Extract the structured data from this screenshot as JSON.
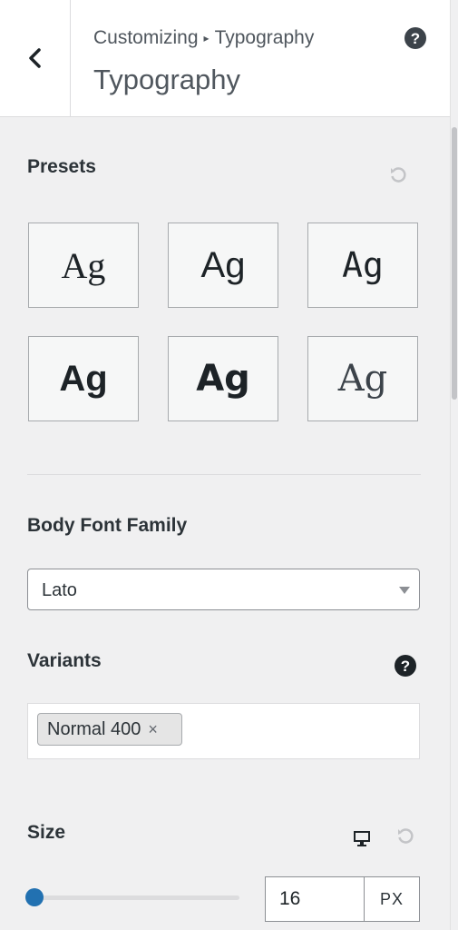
{
  "header": {
    "breadcrumb_parent": "Customizing",
    "breadcrumb_separator": "▸",
    "breadcrumb_current": "Typography",
    "title": "Typography",
    "back_icon": "chevron-left-icon",
    "help_icon": "help-icon"
  },
  "presets": {
    "label": "Presets",
    "reset_icon": "reset-icon",
    "items": [
      {
        "sample": "Ag",
        "style": "serif"
      },
      {
        "sample": "Ag",
        "style": "sans-serif-serif"
      },
      {
        "sample": "Ag",
        "style": "condensed"
      },
      {
        "sample": "Ag",
        "style": "sans-bold-serif"
      },
      {
        "sample": "Ag",
        "style": "sans-bold-serif-2"
      },
      {
        "sample": "Ag",
        "style": "light-serif"
      }
    ]
  },
  "body_font": {
    "label": "Body Font Family",
    "value": "Lato"
  },
  "variants": {
    "label": "Variants",
    "chips": [
      {
        "label": "Normal 400",
        "remove": "×"
      }
    ]
  },
  "size": {
    "label": "Size",
    "value": "16",
    "unit": "PX",
    "slider_fraction": 0.0,
    "device_icon": "desktop-icon",
    "reset_icon": "reset-icon"
  },
  "colors": {
    "accent": "#2271b1",
    "background": "#f0f0f1",
    "header_bg": "#ffffff"
  }
}
